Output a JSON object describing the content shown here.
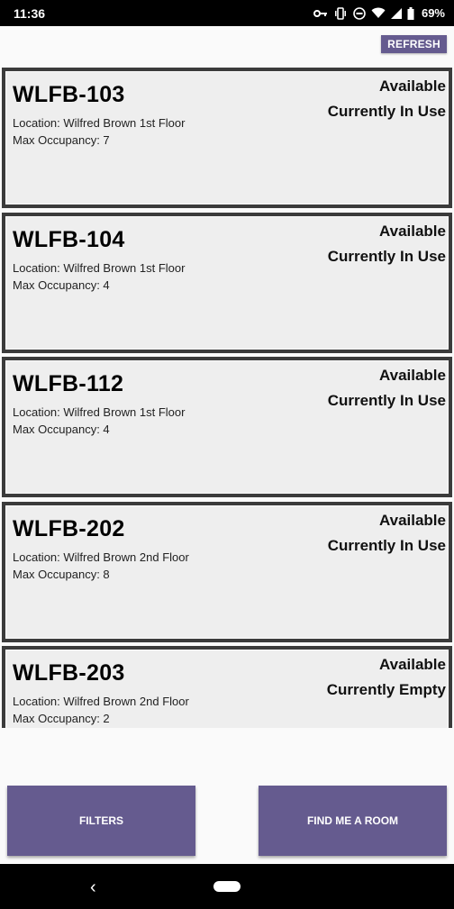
{
  "status_bar": {
    "time": "11:36",
    "battery": "69%",
    "icons": [
      "vpn-key-icon",
      "vibrate-icon",
      "dnd-icon",
      "wifi-icon",
      "signal-icon",
      "battery-icon"
    ]
  },
  "topbar": {
    "refresh_label": "REFRESH"
  },
  "rooms": [
    {
      "name": "WLFB-103",
      "location": "Location: Wilfred Brown 1st Floor",
      "occupancy": "Max Occupancy: 7",
      "availability": "Available",
      "usage": "Currently In Use"
    },
    {
      "name": "WLFB-104",
      "location": "Location: Wilfred Brown 1st Floor",
      "occupancy": "Max Occupancy: 4",
      "availability": "Available",
      "usage": "Currently In Use"
    },
    {
      "name": "WLFB-112",
      "location": "Location: Wilfred Brown 1st Floor",
      "occupancy": "Max Occupancy: 4",
      "availability": "Available",
      "usage": "Currently In Use"
    },
    {
      "name": "WLFB-202",
      "location": "Location: Wilfred Brown 2nd Floor",
      "occupancy": "Max Occupancy: 8",
      "availability": "Available",
      "usage": "Currently In Use"
    },
    {
      "name": "WLFB-203",
      "location": "Location: Wilfred Brown 2nd Floor",
      "occupancy": "Max Occupancy: 2",
      "availability": "Available",
      "usage": "Currently Empty"
    }
  ],
  "actions": {
    "filters_label": "FILTERS",
    "find_label": "FIND ME A ROOM"
  },
  "nav": {
    "back_glyph": "‹"
  },
  "colors": {
    "accent": "#655b8f",
    "card_bg": "#eeeeee",
    "card_border": "#3b3b3b"
  }
}
